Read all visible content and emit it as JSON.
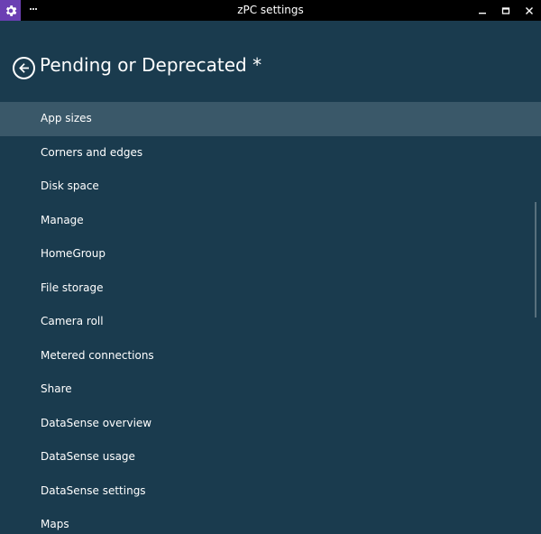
{
  "window": {
    "title": "zPC settings",
    "more_label": "···",
    "app_icon": "gear-icon",
    "controls": [
      "minimize-icon",
      "maximize-icon",
      "close-icon"
    ]
  },
  "header": {
    "title": "Pending or Deprecated *",
    "back_icon": "back-arrow-icon"
  },
  "list": {
    "selected_index": 0,
    "items": [
      "App sizes",
      "Corners and edges",
      "Disk space",
      "Manage",
      "HomeGroup",
      "File storage",
      "Camera roll",
      "Metered connections",
      "Share",
      "DataSense overview",
      "DataSense usage",
      "DataSense settings",
      "Maps"
    ]
  },
  "colors": {
    "background": "#1a3b4e",
    "titlebar": "#000000",
    "app_icon_bg": "#6b3fb3",
    "selected_item": "#3a5869",
    "text": "#ffffff"
  }
}
